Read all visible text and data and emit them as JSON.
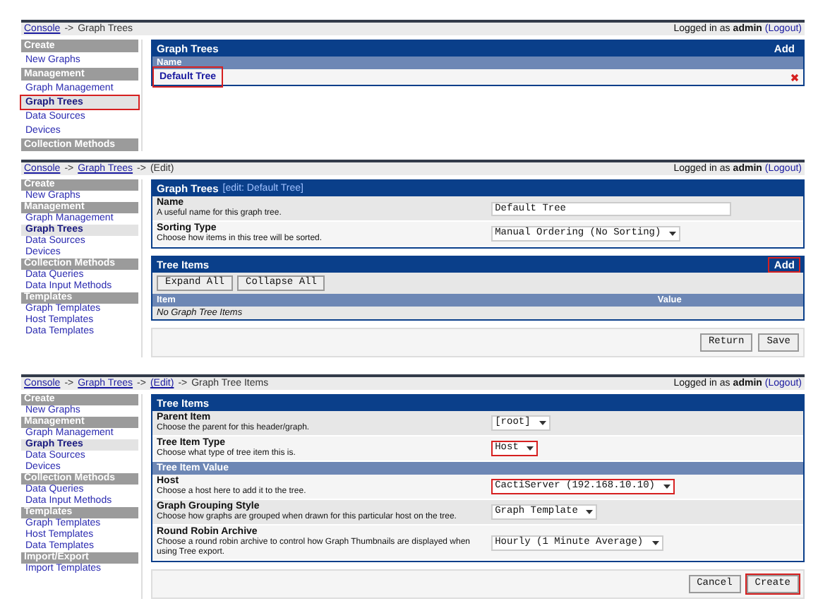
{
  "panels": [
    {
      "kind": "tree_list",
      "breadcrumb": [
        {
          "text": "Console",
          "link": true
        },
        {
          "text": "->",
          "link": false
        },
        {
          "text": "Graph Trees",
          "link": false
        }
      ],
      "login": {
        "prefix": "Logged in as",
        "user": "admin",
        "logout": "(Logout)"
      },
      "sidebar": [
        {
          "kind": "header",
          "label": "Create"
        },
        {
          "kind": "link",
          "label": "New Graphs",
          "selected": false,
          "highlighted": false
        },
        {
          "kind": "header",
          "label": "Management"
        },
        {
          "kind": "link",
          "label": "Graph Management",
          "selected": false,
          "highlighted": false
        },
        {
          "kind": "link",
          "label": "Graph Trees",
          "selected": true,
          "highlighted": true
        },
        {
          "kind": "link",
          "label": "Data Sources",
          "selected": false,
          "highlighted": false
        },
        {
          "kind": "link",
          "label": "Devices",
          "selected": false,
          "highlighted": false
        },
        {
          "kind": "header",
          "label": "Collection Methods"
        }
      ],
      "content": {
        "title": "Graph Trees",
        "action": {
          "label": "Add",
          "highlighted": false
        },
        "column": "Name",
        "rows": [
          {
            "name": "Default Tree",
            "highlighted": true
          }
        ]
      }
    },
    {
      "kind": "tree_edit",
      "breadcrumb": [
        {
          "text": "Console",
          "link": true
        },
        {
          "text": "->",
          "link": false
        },
        {
          "text": "Graph Trees",
          "link": true
        },
        {
          "text": "->",
          "link": false
        },
        {
          "text": "(Edit)",
          "link": false
        }
      ],
      "login": {
        "prefix": "Logged in as",
        "user": "admin",
        "logout": "(Logout)"
      },
      "sidebar": [
        {
          "kind": "header",
          "label": "Create"
        },
        {
          "kind": "link",
          "label": "New Graphs",
          "selected": false,
          "highlighted": false
        },
        {
          "kind": "header",
          "label": "Management"
        },
        {
          "kind": "link",
          "label": "Graph Management",
          "selected": false,
          "highlighted": false
        },
        {
          "kind": "link",
          "label": "Graph Trees",
          "selected": true,
          "highlighted": false
        },
        {
          "kind": "link",
          "label": "Data Sources",
          "selected": false,
          "highlighted": false
        },
        {
          "kind": "link",
          "label": "Devices",
          "selected": false,
          "highlighted": false
        },
        {
          "kind": "header",
          "label": "Collection Methods"
        },
        {
          "kind": "link",
          "label": "Data Queries",
          "selected": false,
          "highlighted": false
        },
        {
          "kind": "link",
          "label": "Data Input Methods",
          "selected": false,
          "highlighted": false
        },
        {
          "kind": "header",
          "label": "Templates"
        },
        {
          "kind": "link",
          "label": "Graph Templates",
          "selected": false,
          "highlighted": false
        },
        {
          "kind": "link",
          "label": "Host Templates",
          "selected": false,
          "highlighted": false
        },
        {
          "kind": "link",
          "label": "Data Templates",
          "selected": false,
          "highlighted": false
        }
      ],
      "content": {
        "title": "Graph Trees",
        "subtitle": "[edit: Default Tree]",
        "fields": [
          {
            "kind": "text",
            "label": "Name",
            "description": "A useful name for this graph tree.",
            "value": "Default Tree",
            "highlighted": false
          },
          {
            "kind": "select",
            "label": "Sorting Type",
            "description": "Choose how items in this tree will be sorted.",
            "value": "Manual Ordering (No Sorting)",
            "highlighted": false
          }
        ],
        "items": {
          "title": "Tree Items",
          "action": {
            "label": "Add",
            "highlighted": true
          },
          "buttons": [
            "Expand All",
            "Collapse All"
          ],
          "columns": [
            "Item",
            "Value"
          ],
          "empty": "No Graph Tree Items"
        },
        "buttons": [
          {
            "label": "Return",
            "highlighted": false
          },
          {
            "label": "Save",
            "highlighted": false
          }
        ]
      }
    },
    {
      "kind": "item_edit",
      "breadcrumb": [
        {
          "text": "Console",
          "link": true
        },
        {
          "text": "->",
          "link": false
        },
        {
          "text": "Graph Trees",
          "link": true
        },
        {
          "text": "->",
          "link": false
        },
        {
          "text": "(Edit)",
          "link": true
        },
        {
          "text": "->",
          "link": false
        },
        {
          "text": "Graph Tree Items",
          "link": false
        }
      ],
      "login": {
        "prefix": "Logged in as",
        "user": "admin",
        "logout": "(Logout)"
      },
      "sidebar": [
        {
          "kind": "header",
          "label": "Create"
        },
        {
          "kind": "link",
          "label": "New Graphs",
          "selected": false,
          "highlighted": false
        },
        {
          "kind": "header",
          "label": "Management"
        },
        {
          "kind": "link",
          "label": "Graph Management",
          "selected": false,
          "highlighted": false
        },
        {
          "kind": "link",
          "label": "Graph Trees",
          "selected": true,
          "highlighted": false
        },
        {
          "kind": "link",
          "label": "Data Sources",
          "selected": false,
          "highlighted": false
        },
        {
          "kind": "link",
          "label": "Devices",
          "selected": false,
          "highlighted": false
        },
        {
          "kind": "header",
          "label": "Collection Methods"
        },
        {
          "kind": "link",
          "label": "Data Queries",
          "selected": false,
          "highlighted": false
        },
        {
          "kind": "link",
          "label": "Data Input Methods",
          "selected": false,
          "highlighted": false
        },
        {
          "kind": "header",
          "label": "Templates"
        },
        {
          "kind": "link",
          "label": "Graph Templates",
          "selected": false,
          "highlighted": false
        },
        {
          "kind": "link",
          "label": "Host Templates",
          "selected": false,
          "highlighted": false
        },
        {
          "kind": "link",
          "label": "Data Templates",
          "selected": false,
          "highlighted": false
        },
        {
          "kind": "header",
          "label": "Import/Export"
        },
        {
          "kind": "link",
          "label": "Import Templates",
          "selected": false,
          "highlighted": false
        }
      ],
      "content": {
        "title": "Tree Items",
        "fields": [
          {
            "kind": "select",
            "label": "Parent Item",
            "description": "Choose the parent for this header/graph.",
            "value": "[root]",
            "highlighted": false
          },
          {
            "kind": "select",
            "label": "Tree Item Type",
            "description": "Choose what type of tree item this is.",
            "value": "Host",
            "highlighted": true
          },
          {
            "kind": "section",
            "label": "Tree Item Value"
          },
          {
            "kind": "select",
            "label": "Host",
            "description": "Choose a host here to add it to the tree.",
            "value": "CactiServer (192.168.10.10)",
            "highlighted": true
          },
          {
            "kind": "select",
            "label": "Graph Grouping Style",
            "description": "Choose how graphs are grouped when drawn for this particular host on the tree.",
            "value": "Graph Template",
            "highlighted": false
          },
          {
            "kind": "select",
            "label": "Round Robin Archive",
            "description": "Choose a round robin archive to control how Graph Thumbnails are displayed when using Tree export.",
            "value": "Hourly (1 Minute Average)",
            "highlighted": false
          }
        ],
        "buttons": [
          {
            "label": "Cancel",
            "highlighted": false
          },
          {
            "label": "Create",
            "highlighted": true
          }
        ]
      }
    }
  ]
}
